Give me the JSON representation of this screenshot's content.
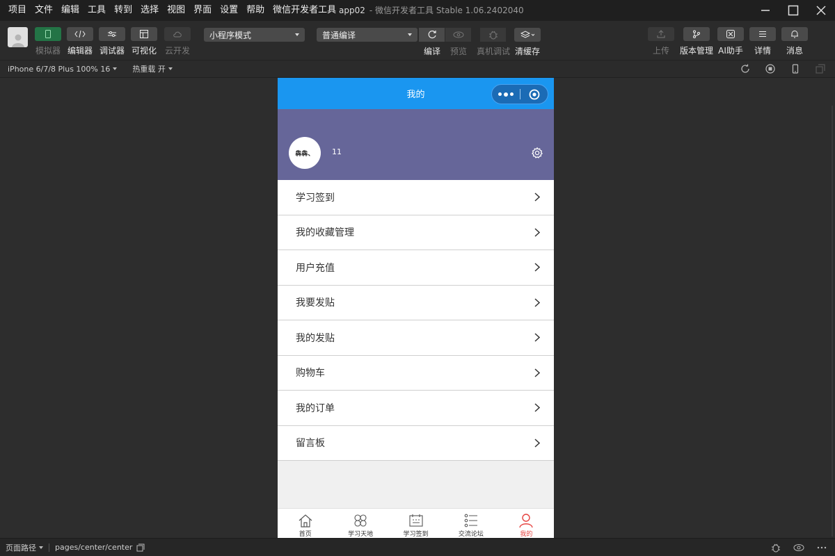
{
  "menubar": {
    "items": [
      "项目",
      "文件",
      "编辑",
      "工具",
      "转到",
      "选择",
      "视图",
      "界面",
      "设置",
      "帮助",
      "微信开发者工具"
    ],
    "app_name": "app02",
    "title_suffix": "- 微信开发者工具 Stable 1.06.2402040"
  },
  "toolbar": {
    "left": [
      "模拟器",
      "编辑器",
      "调试器",
      "可视化",
      "云开发"
    ],
    "mode_select": "小程序模式",
    "compile_select": "普通编译",
    "actions": [
      "编译",
      "预览",
      "真机调试",
      "清缓存"
    ],
    "right": [
      "上传",
      "版本管理",
      "AI助手",
      "详情",
      "消息"
    ]
  },
  "subbar": {
    "device": "iPhone 6/7/8 Plus 100% 16",
    "hot_reload": "热重载 开"
  },
  "phone": {
    "nav_title": "我的",
    "user": {
      "avatar_text": "犇犇、",
      "name": "11"
    },
    "menu": [
      "学习签到",
      "我的收藏管理",
      "用户充值",
      "我要发贴",
      "我的发贴",
      "购物车",
      "我的订单",
      "留言板"
    ],
    "tabs": [
      "首页",
      "学习天地",
      "学习签到",
      "交流论坛",
      "我的"
    ],
    "colors": {
      "navbar": "#1a96f0",
      "header": "#666699",
      "tab_active": "#e64340"
    }
  },
  "statusbar": {
    "path_label": "页面路径",
    "path": "pages/center/center"
  }
}
